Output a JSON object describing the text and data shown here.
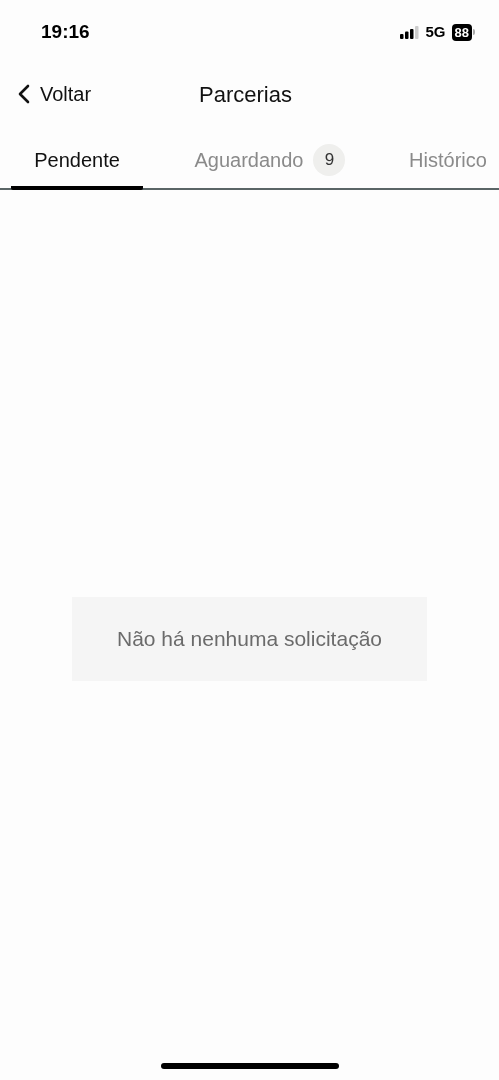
{
  "status_bar": {
    "time": "19:16",
    "network": "5G",
    "battery": "88"
  },
  "nav": {
    "back": "Voltar",
    "title": "Parcerias"
  },
  "tabs": [
    {
      "label": "Pendente",
      "selected": true
    },
    {
      "label": "Aguardando",
      "selected": false,
      "badge": "9"
    },
    {
      "label": "Histórico",
      "selected": false
    }
  ],
  "empty_message": "Não há nenhuma solicitação"
}
